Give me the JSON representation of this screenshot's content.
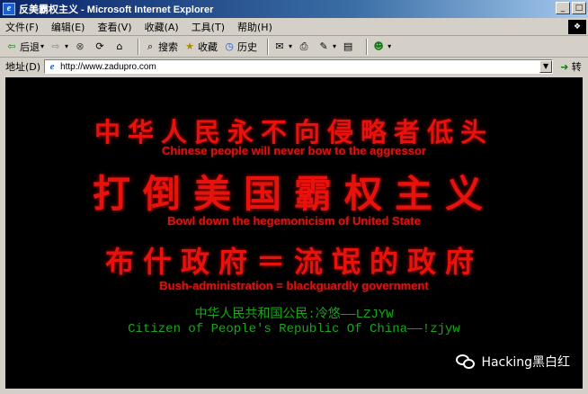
{
  "window": {
    "title": "反美霸权主义 - Microsoft Internet Explorer",
    "controls": {
      "minimize": "_",
      "maximize": "□",
      "close": "×"
    }
  },
  "menu": {
    "items": [
      "文件(F)",
      "编辑(E)",
      "查看(V)",
      "收藏(A)",
      "工具(T)",
      "帮助(H)"
    ]
  },
  "toolbar": {
    "back_label": "后退",
    "search_label": "搜索",
    "favorites_label": "收藏",
    "history_label": "历史"
  },
  "address": {
    "label": "地址(D)",
    "url": "http://www.zadupro.com",
    "go_label": "转"
  },
  "content": {
    "line1": "中华人民永不向侵略者低头",
    "line2": "Chinese people will never bow to the aggressor",
    "line3": "打倒美国霸权主义",
    "line4": "Bowl down the hegemonicism of United State",
    "line5": "布什政府＝流氓的政府",
    "line6": "Bush-administration = blackguardly government",
    "line7": "中华人民共和国公民:冷悠——LZJYW",
    "line8": "Citizen of People's Republic Of China——!zjyw"
  },
  "watermark": {
    "text": "Hacking黑白红"
  },
  "colors": {
    "slogan_red": "#e8120c",
    "signature_green": "#1aa51a",
    "titlebar_blue": "#0a246a"
  }
}
